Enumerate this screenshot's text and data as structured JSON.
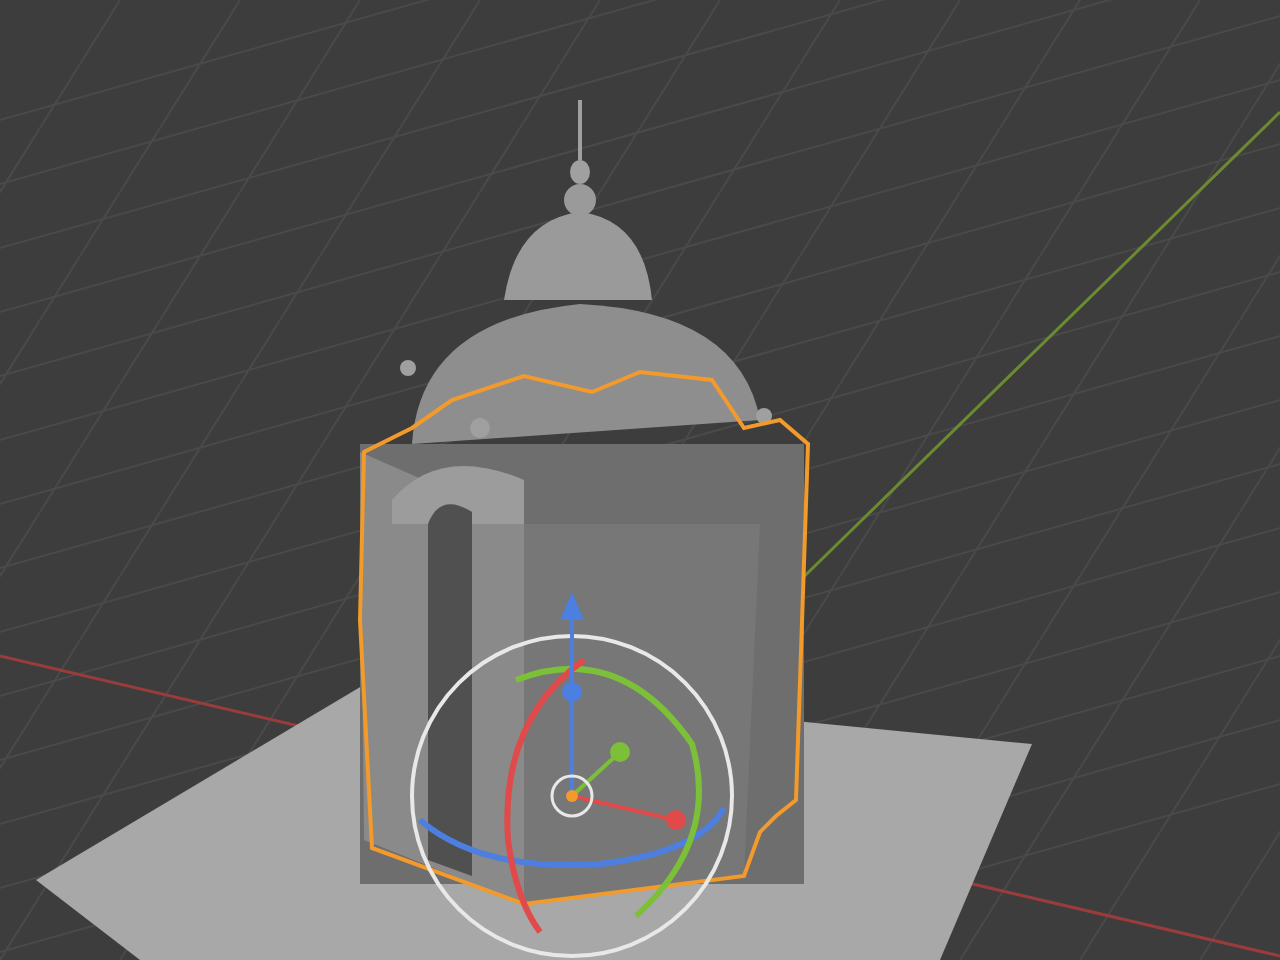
{
  "viewport": {
    "object_selected": true,
    "rotate_gizmo_shown": true
  }
}
